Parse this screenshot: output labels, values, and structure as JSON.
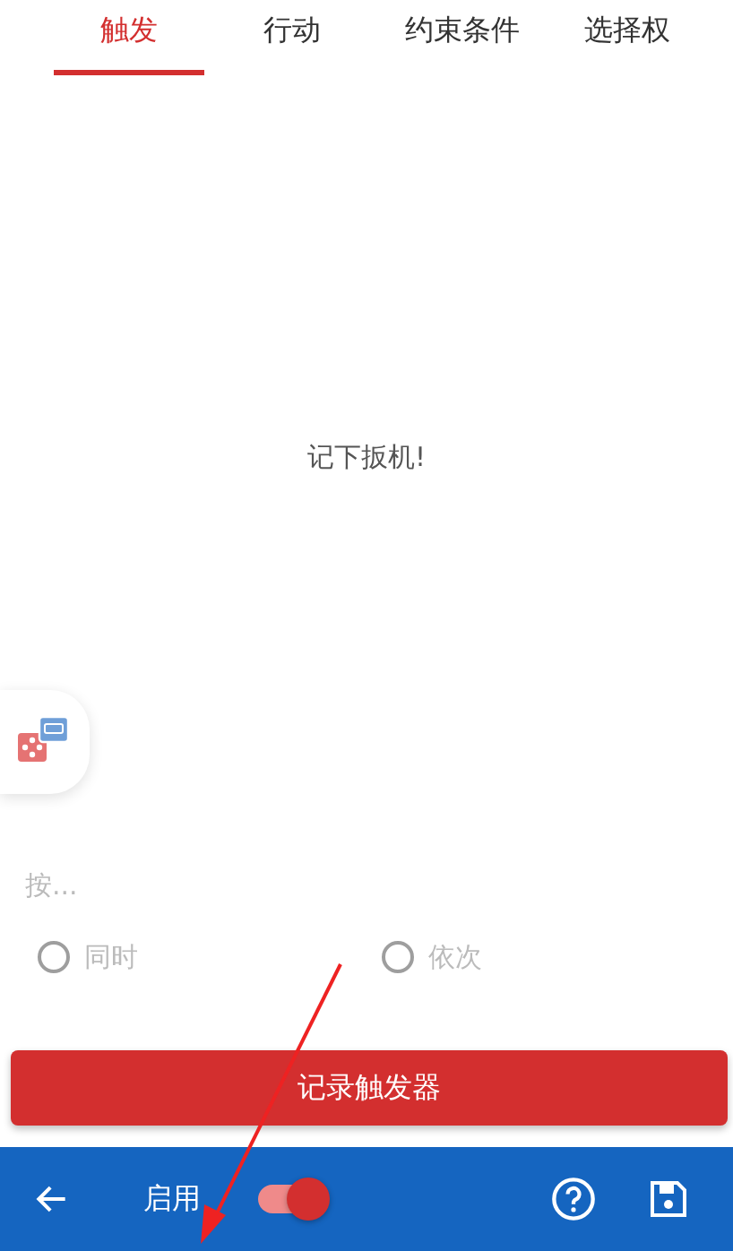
{
  "tabs": [
    {
      "label": "触发",
      "selected": true
    },
    {
      "label": "行动",
      "selected": false
    },
    {
      "label": "约束条件",
      "selected": false
    },
    {
      "label": "选择权",
      "selected": false
    }
  ],
  "message": "记下扳机!",
  "input": {
    "placeholder": "按..."
  },
  "radios": [
    {
      "label": "同时",
      "selected": false,
      "disabled": true
    },
    {
      "label": "依次",
      "selected": false,
      "disabled": true
    }
  ],
  "record_button": "记录触发器",
  "bottom_bar": {
    "enable_label": "启用",
    "enabled": {
      "on": true
    }
  }
}
